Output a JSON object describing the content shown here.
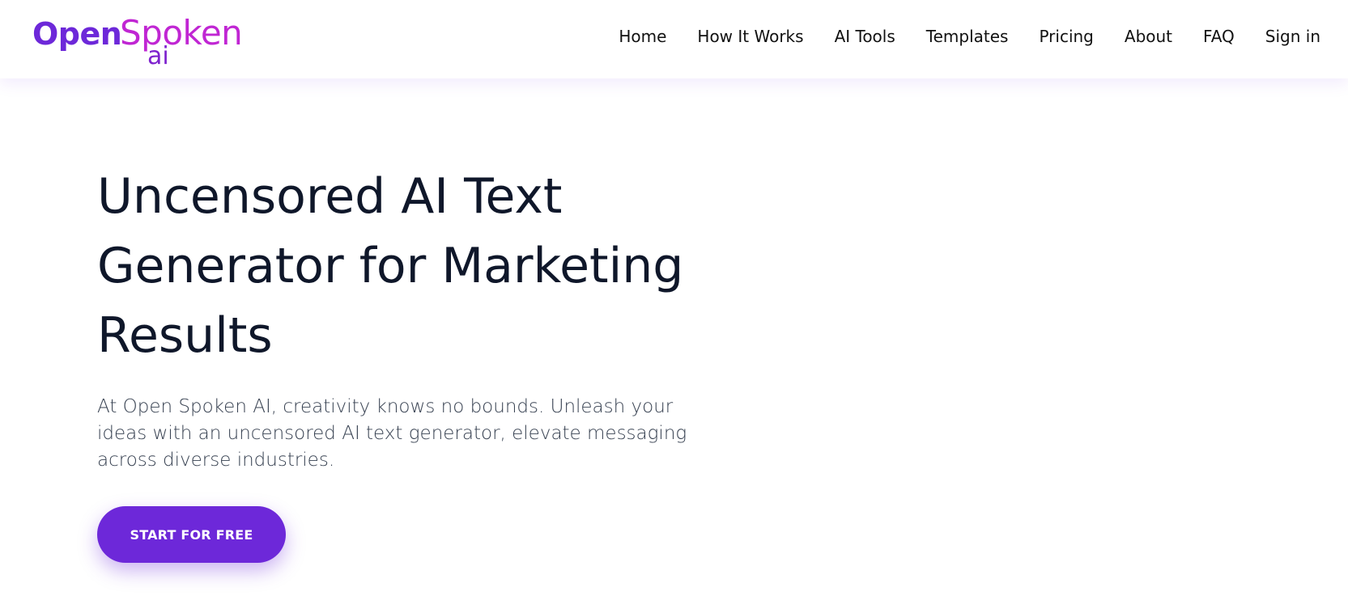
{
  "brand": {
    "open": "Open",
    "spoken": "Spoken",
    "ai": "ai",
    "colors": {
      "open": "#6d28d9",
      "spoken": "#c026d3",
      "ai": "#7e22ce"
    }
  },
  "nav": {
    "items": [
      {
        "label": "Home"
      },
      {
        "label": "How It Works"
      },
      {
        "label": "AI Tools"
      },
      {
        "label": "Templates"
      },
      {
        "label": "Pricing"
      },
      {
        "label": "About"
      },
      {
        "label": "FAQ"
      },
      {
        "label": "Sign in"
      }
    ]
  },
  "hero": {
    "title": "Uncensored AI Text Generator for Marketing Results",
    "description": "At Open Spoken AI, creativity knows no bounds. Unleash your ideas with an uncensored AI text generator, elevate messaging across diverse industries.",
    "cta_label": "START FOR FREE"
  },
  "colors": {
    "accent": "#6d28d9",
    "heading": "#0f172a",
    "body_text": "#374151"
  }
}
